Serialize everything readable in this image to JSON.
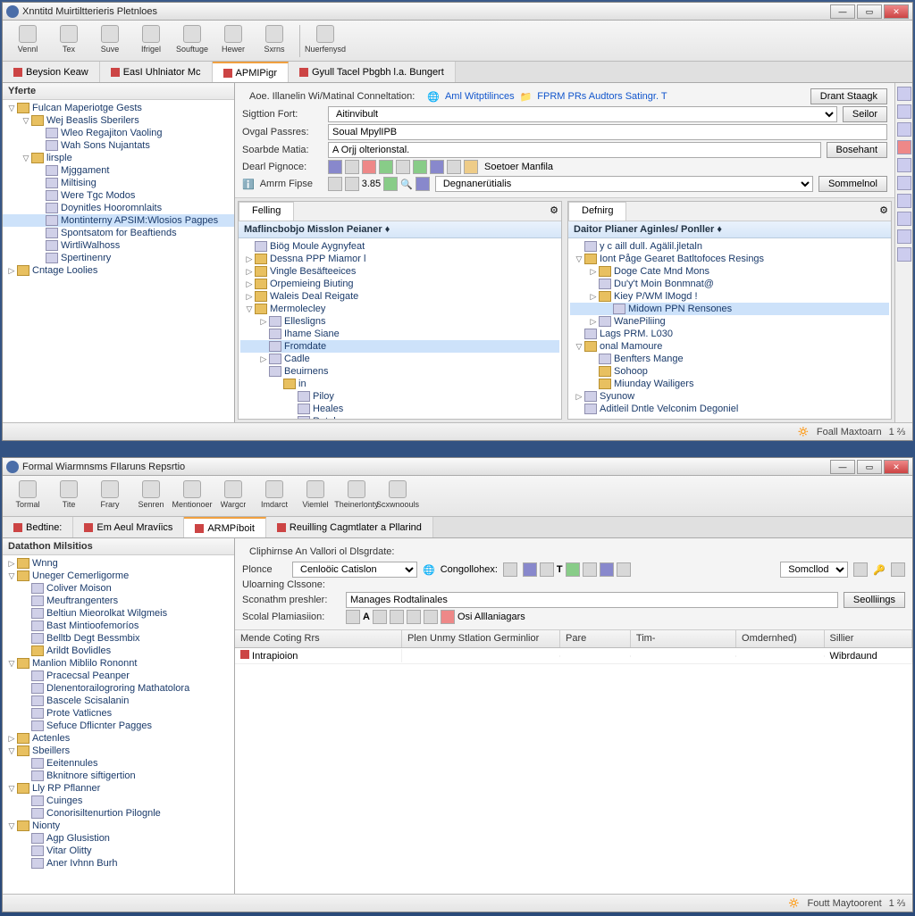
{
  "top": {
    "title": "Xnntitd Muirtiltterieris Pletnloes",
    "toolbar": [
      {
        "label": "Vennl"
      },
      {
        "label": "Tex"
      },
      {
        "label": "Suve"
      },
      {
        "label": "Ifrigel"
      },
      {
        "label": "Souftuge"
      },
      {
        "label": "Hewer"
      },
      {
        "label": "Sxrns"
      },
      {
        "label": "Nuerfenysd"
      }
    ],
    "tabs": [
      {
        "label": "Beysion Keaw"
      },
      {
        "label": "EasI Uhlniator Mc"
      },
      {
        "label": "APMIPigr",
        "active": true
      },
      {
        "label": "Gyull Tacel Pbgbh l.a. Bungert"
      }
    ],
    "side_head": "Yferte",
    "tree": [
      {
        "l": "Fulcan Maperiotge Gests",
        "d": 0,
        "t": "▽",
        "ic": "folder"
      },
      {
        "l": "Wej Beaslis Sberilers",
        "d": 1,
        "t": "▽",
        "ic": "folder"
      },
      {
        "l": "Wleo Regajiton Vaoling",
        "d": 2,
        "ic": "file"
      },
      {
        "l": "Wah Sons Nujantats",
        "d": 2,
        "ic": "file"
      },
      {
        "l": "lirsple",
        "d": 1,
        "t": "▽",
        "ic": "folder"
      },
      {
        "l": "Mjggament",
        "d": 2,
        "ic": "file"
      },
      {
        "l": "Miltising",
        "d": 2,
        "ic": "file"
      },
      {
        "l": "Were Tgc Modos",
        "d": 2,
        "ic": "file"
      },
      {
        "l": "Doynitles Hooromnlaits",
        "d": 2,
        "ic": "file"
      },
      {
        "l": "Montinterny APSIM:Wlosios Pagpes",
        "d": 2,
        "ic": "file",
        "sel": true
      },
      {
        "l": "Spontsatom for Beaftiends",
        "d": 2,
        "ic": "file"
      },
      {
        "l": "WirtliWalhoss",
        "d": 2,
        "ic": "file"
      },
      {
        "l": "Spertinenry",
        "d": 2,
        "ic": "file"
      },
      {
        "l": "Cntage Loolies",
        "d": 0,
        "t": "▷",
        "ic": "folder"
      }
    ],
    "form": {
      "breadcrumb": "Aoe. Illanelin Wi/Matinal Conneltation:",
      "crumb_links": [
        "Aml Witptilinces",
        "FPRM PRs Audtors Satingr. T"
      ],
      "row1_label": "Sigttion Fort:",
      "row1_value": "Aitinvibult",
      "row2_label": "Ovgal Passres:",
      "row2_value": "Soual MpylIPB",
      "row3_label": "Soarbde Matia:",
      "row3_value": "A Orjj olterionstal.",
      "row4_label": "Dearl Pignoce:",
      "row5_label": "Amrm Fipse",
      "row5_value": "Degnanerütialis",
      "btn1": "Drant Staagk",
      "btn2": "Seilor",
      "btn3": "Bosehant",
      "btn4": "Sommelnol",
      "strip_label": "Soetoer Manfila",
      "strip_num": "3.85"
    },
    "left_pane": {
      "tab": "Felling",
      "head": "Maflincbobjo Misslon Peianer ♦",
      "items": [
        {
          "l": "Biög Moule Aygnyfeat",
          "d": 0,
          "ic": "file"
        },
        {
          "l": "Dessna PPP Miamor l",
          "d": 0,
          "t": "▷",
          "ic": "folder"
        },
        {
          "l": "Vingle Besäfteeices",
          "d": 0,
          "t": "▷",
          "ic": "folder"
        },
        {
          "l": "Orpemieing Biuting",
          "d": 0,
          "t": "▷",
          "ic": "folder"
        },
        {
          "l": "Waleis Deal Reigate",
          "d": 0,
          "t": "▷",
          "ic": "folder"
        },
        {
          "l": "Mermolecley",
          "d": 0,
          "t": "▽",
          "ic": "folder"
        },
        {
          "l": "Ellesligns",
          "d": 1,
          "t": "▷",
          "ic": "file"
        },
        {
          "l": "Ihame Siane",
          "d": 1,
          "ic": "file"
        },
        {
          "l": "Fromdate",
          "d": 1,
          "ic": "file",
          "sel": true
        },
        {
          "l": "Cadle",
          "d": 1,
          "t": "▷",
          "ic": "file"
        },
        {
          "l": "Beuirnens",
          "d": 1,
          "ic": "file"
        },
        {
          "l": "in",
          "d": 2,
          "ic": "folder"
        },
        {
          "l": "Piloy",
          "d": 3,
          "ic": "file"
        },
        {
          "l": "Heales",
          "d": 3,
          "ic": "file"
        },
        {
          "l": "Ratole",
          "d": 3,
          "ic": "file"
        }
      ]
    },
    "right_pane": {
      "tab": "Defnirg",
      "head": "Daitor Plianer Aginles/ Ponller ♦",
      "items": [
        {
          "l": "y c aill dull. Agälil.jletaln",
          "d": 0,
          "ic": "file"
        },
        {
          "l": "Iont Påge Gearet Batltofoces Resings",
          "d": 0,
          "t": "▽",
          "ic": "folder"
        },
        {
          "l": "Doge Cate Mnd Mons",
          "d": 1,
          "t": "▷",
          "ic": "folder"
        },
        {
          "l": "Du'y't Moin Bonmnat@",
          "d": 1,
          "ic": "file"
        },
        {
          "l": "Kiey P/WM lMogd !",
          "d": 1,
          "t": "▷",
          "ic": "folder"
        },
        {
          "l": "Midown PPN Rensones",
          "d": 2,
          "ic": "file",
          "sel": true
        },
        {
          "l": "WanePiliing",
          "d": 1,
          "t": "▷",
          "ic": "file"
        },
        {
          "l": "Lags PRM. L030",
          "d": 0,
          "ic": "file"
        },
        {
          "l": "onal Mamoure",
          "d": 0,
          "t": "▽",
          "ic": "folder"
        },
        {
          "l": "Benfters Mange",
          "d": 1,
          "ic": "file"
        },
        {
          "l": "Sohoop",
          "d": 1,
          "ic": "folder"
        },
        {
          "l": "Miunday Wailigers",
          "d": 1,
          "ic": "folder"
        },
        {
          "l": "Syunow",
          "d": 0,
          "t": "▷",
          "ic": "file"
        },
        {
          "l": "Aditleil Dntle Velconim Degoniel",
          "d": 0,
          "ic": "file"
        }
      ]
    },
    "status": {
      "label": "Foall Maxtoarn",
      "count": "1 ⅔"
    }
  },
  "bottom": {
    "title": "Formal Wiarmnsms FIlaruns Repsrtio",
    "toolbar": [
      {
        "label": "Tormal"
      },
      {
        "label": "Tite"
      },
      {
        "label": "Frary"
      },
      {
        "label": "Senren"
      },
      {
        "label": "Mentionoer"
      },
      {
        "label": "Wargcr"
      },
      {
        "label": "Imdarct"
      },
      {
        "label": "Viemlel"
      },
      {
        "label": "Theinerlonty"
      },
      {
        "label": "Scxwnoouls"
      }
    ],
    "tabs": [
      {
        "label": "Bedtine:"
      },
      {
        "label": "Em Aeul Mravíics"
      },
      {
        "label": "ARMPíboit",
        "active": true
      },
      {
        "label": "Reuilling Cagmtlater a Pllarind"
      }
    ],
    "side_head": "Datathon Milsitios",
    "tree": [
      {
        "l": "Wnng",
        "d": 0,
        "t": "▷",
        "ic": "folder"
      },
      {
        "l": "Uneger Cemerligorme",
        "d": 0,
        "t": "▽",
        "ic": "folder"
      },
      {
        "l": "Coliver Moison",
        "d": 1,
        "ic": "file"
      },
      {
        "l": "Meuftrangenters",
        "d": 1,
        "ic": "file"
      },
      {
        "l": "Beltiun Mieorolkat Wilgmeis",
        "d": 1,
        "ic": "file"
      },
      {
        "l": "Bast Mintioofemoríos",
        "d": 1,
        "ic": "file"
      },
      {
        "l": "Belltb Degt Bessmbix",
        "d": 1,
        "ic": "file"
      },
      {
        "l": "Arildt Bovlidles",
        "d": 1,
        "ic": "folder"
      },
      {
        "l": "Manlion Miblilo Rononnt",
        "d": 0,
        "t": "▽",
        "ic": "folder"
      },
      {
        "l": "Pracecsal Peanper",
        "d": 1,
        "ic": "file"
      },
      {
        "l": "Dlenentorailogroring Mathatolora",
        "d": 1,
        "ic": "file"
      },
      {
        "l": "Bascele Scisalanin",
        "d": 1,
        "ic": "file"
      },
      {
        "l": "Prote Vatlicnes",
        "d": 1,
        "ic": "file"
      },
      {
        "l": "Sefuce Dflicnter Pagges",
        "d": 1,
        "ic": "file"
      },
      {
        "l": "Actenles",
        "d": 0,
        "t": "▷",
        "ic": "folder"
      },
      {
        "l": "Sbeillers",
        "d": 0,
        "t": "▽",
        "ic": "folder"
      },
      {
        "l": "Eeitennules",
        "d": 1,
        "ic": "file"
      },
      {
        "l": "Bknitnore siftigertion",
        "d": 1,
        "ic": "file"
      },
      {
        "l": "Lly RP Pflanner",
        "d": 0,
        "t": "▽",
        "ic": "folder"
      },
      {
        "l": "Cuinges",
        "d": 1,
        "ic": "file"
      },
      {
        "l": "Conorisiltenurtion Pilognle",
        "d": 1,
        "ic": "file"
      },
      {
        "l": "Nionty",
        "d": 0,
        "t": "▽",
        "ic": "folder"
      },
      {
        "l": "Agp Glusistion",
        "d": 1,
        "ic": "file"
      },
      {
        "l": "Vitar Olitty",
        "d": 1,
        "ic": "file"
      },
      {
        "l": "Aner Ivhnn Burh",
        "d": 1,
        "ic": "file"
      }
    ],
    "form": {
      "breadcrumb": "Cliphirnse An Vallori ol Dlsgrdate:",
      "row1_label": "Plonce",
      "row1_value": "Cenloöic Catislon",
      "row1_extra": "Congollohex:",
      "row2_label": "Uloarning Clssone:",
      "row3_label": "Sconathm preshler:",
      "row3_value": "Manages Rodtalinales",
      "row4_label": "Scolal Plamiasiion:",
      "row4_extra": "Osi Alllaniagars",
      "btn1": "Somcllod",
      "btn2": "Seolliings"
    },
    "table": {
      "cols": [
        "Mende Coting Rrs",
        "Plen Unmy Stlation Germinlior",
        "Pare",
        "Tim-",
        "Omdernhed)",
        "Sillier"
      ],
      "widths": [
        190,
        180,
        80,
        120,
        100,
        100
      ],
      "rows": [
        {
          "c0": "Intrapioion",
          "c5": "Wibrdaund"
        }
      ]
    },
    "status": {
      "label": "Foutt Maytoorent",
      "count": "1 ⅔"
    }
  }
}
